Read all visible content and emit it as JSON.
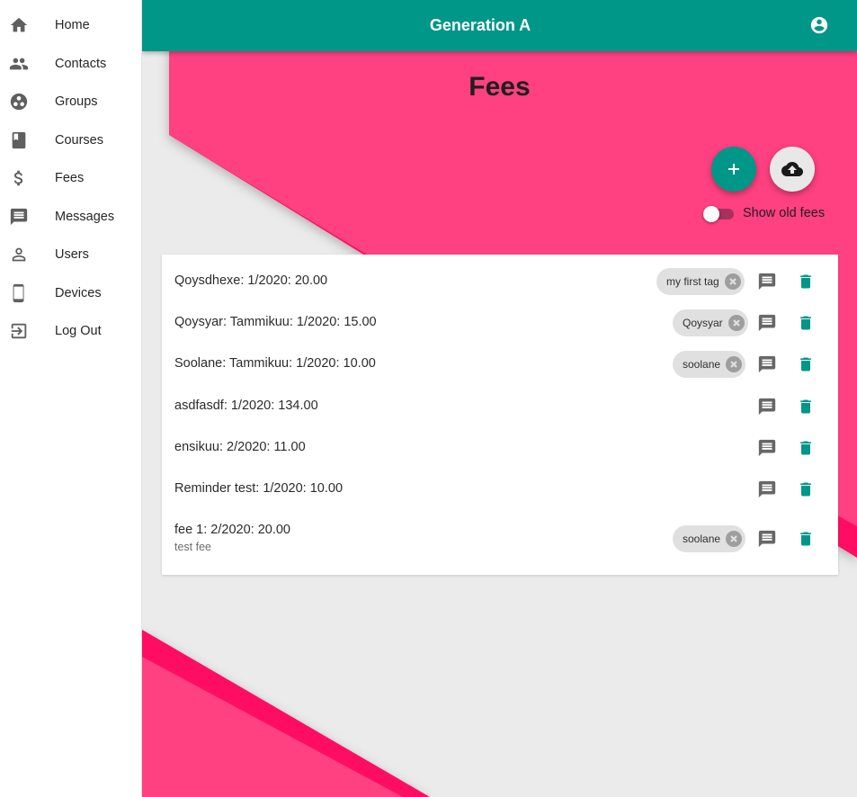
{
  "colors": {
    "primary": "#009688",
    "accent": "#ff4081",
    "accent_dark": "#ff0a63",
    "background": "#ebebeb"
  },
  "sidebar": {
    "items": [
      {
        "label": "Home",
        "icon": "home-icon"
      },
      {
        "label": "Contacts",
        "icon": "people-icon"
      },
      {
        "label": "Groups",
        "icon": "group-work-icon"
      },
      {
        "label": "Courses",
        "icon": "book-icon"
      },
      {
        "label": "Fees",
        "icon": "dollar-icon"
      },
      {
        "label": "Messages",
        "icon": "message-icon"
      },
      {
        "label": "Users",
        "icon": "person-icon"
      },
      {
        "label": "Devices",
        "icon": "phone-icon"
      },
      {
        "label": "Log Out",
        "icon": "logout-icon"
      }
    ]
  },
  "header": {
    "title": "Generation A",
    "account_icon": "account-circle-icon"
  },
  "page": {
    "title": "Fees",
    "add_icon": "plus-icon",
    "upload_icon": "cloud-upload-icon",
    "show_old_label": "Show old fees",
    "show_old_enabled": false
  },
  "fees": [
    {
      "text": "Qoysdhexe: 1/2020: 20.00",
      "tag": "my first tag"
    },
    {
      "text": "Qoysyar: Tammikuu: 1/2020: 15.00",
      "tag": "Qoysyar"
    },
    {
      "text": "Soolane: Tammikuu: 1/2020: 10.00",
      "tag": "soolane"
    },
    {
      "text": "asdfasdf: 1/2020: 134.00",
      "tag": null
    },
    {
      "text": "ensikuu: 2/2020: 11.00",
      "tag": null
    },
    {
      "text": "Reminder test: 1/2020: 10.00",
      "tag": null
    },
    {
      "text": "fee 1: 2/2020: 20.00",
      "sub": "test fee",
      "tag": "soolane"
    }
  ]
}
